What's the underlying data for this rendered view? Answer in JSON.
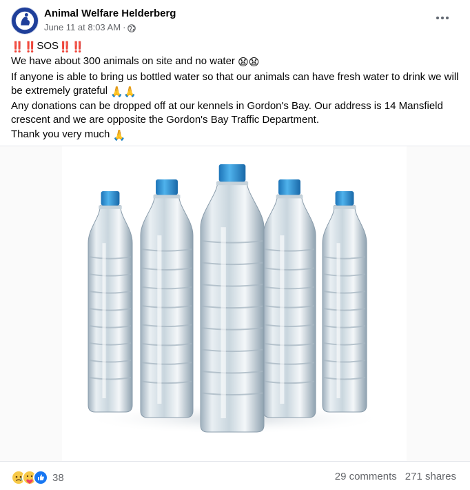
{
  "post": {
    "author": "Animal Welfare Helderberg",
    "timestamp": "June 11 at 8:03 AM",
    "separator": "·",
    "privacy_icon": "globe-icon",
    "avatar_text": "Animal Welfare Helderberg",
    "more_icon": "more-options-icon",
    "lines": [
      "SOS",
      "We have about 300 animals on site and no water",
      "If anyone is able to bring us bottled water so that our animals can have fresh water to drink we will be extremely grateful",
      "Any donations can be dropped off at our kennels in Gordon's Bay. Our address is 14 Mansfield crescent and we are opposite the Gordon's Bay Traffic Department.",
      "Thank you very much"
    ],
    "emojis": {
      "alarm": "‼️",
      "sad": "😧",
      "pray": "🙏"
    }
  },
  "footer": {
    "reaction_icons": [
      "sad-reaction-icon",
      "care-reaction-icon",
      "like-reaction-icon"
    ],
    "reaction_count": "38",
    "comments": "29 comments",
    "shares": "271 shares"
  },
  "colors": {
    "brand_blue": "#1877f2",
    "avatar_blue": "#1f3f9a",
    "text_secondary": "#65676b",
    "alarm_red": "#e0245e"
  }
}
